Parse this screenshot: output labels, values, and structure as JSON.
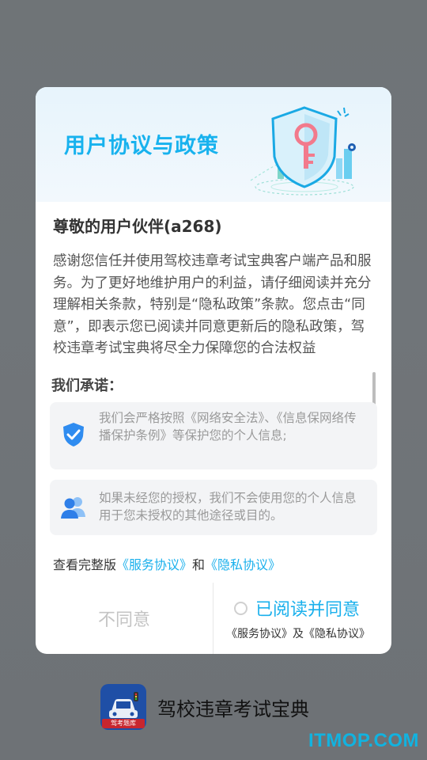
{
  "dialog": {
    "title": "用户协议与政策",
    "greeting": "尊敬的用户伙伴(a268)",
    "intro": "感谢您信任并使用驾校违章考试宝典客户端产品和服务。为了更好地维护用户的利益，请仔细阅读并充分理解相关条款，特别是“隐私政策”条款。您点击“同意”，即表示您已阅读并同意更新后的隐私政策，驾校违章考试宝典将尽全力保障您的合法权益",
    "promise_title": "我们承诺：",
    "promises": [
      {
        "icon": "shield-check-icon",
        "text": "我们会严格按照《网络安全法》、《信息保网络传播保护条例》等保护您的个人信息;"
      },
      {
        "icon": "users-icon",
        "text": "如果未经您的授权，我们不会使用您的个人信息用于您未授权的其他途径或目的。"
      }
    ],
    "links": {
      "prefix": "查看完整版",
      "service": "《服务协议》",
      "and": "和",
      "privacy": "《隐私协议》"
    },
    "disagree_label": "不同意",
    "agree_label": "已阅读并同意",
    "agree_sub": "《服务协议》及《隐私协议》"
  },
  "app": {
    "name": "驾校违章考试宝典",
    "icon_badge": "驾考题库"
  },
  "watermark": "ITMOP.COM",
  "colors": {
    "accent": "#1ab0ec",
    "overlay": "#6f7477",
    "card_bg": "#f3f4f6"
  }
}
